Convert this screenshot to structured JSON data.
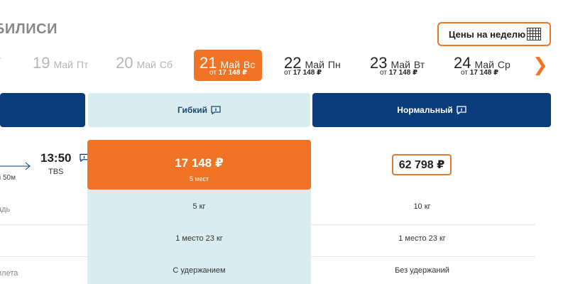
{
  "header": {
    "title": "БИЛИСИ",
    "week_button_label": "Цены на неделю"
  },
  "dates": [
    {
      "day": "",
      "month": "",
      "dow": "т",
      "price_prefix": "",
      "price": "",
      "state": "faded"
    },
    {
      "day": "19",
      "month": "Май",
      "dow": "Пт",
      "price_prefix": "",
      "price": "",
      "state": "faded"
    },
    {
      "day": "20",
      "month": "Май",
      "dow": "Сб",
      "price_prefix": "",
      "price": "",
      "state": "faded"
    },
    {
      "day": "21",
      "month": "Май",
      "dow": "Вс",
      "price_prefix": "от",
      "price": "17 148 ₽",
      "state": "active"
    },
    {
      "day": "22",
      "month": "Май",
      "dow": "Пн",
      "price_prefix": "от",
      "price": "17 148 ₽",
      "state": "normal"
    },
    {
      "day": "23",
      "month": "Май",
      "dow": "Вт",
      "price_prefix": "от",
      "price": "17 148 ₽",
      "state": "normal"
    },
    {
      "day": "24",
      "month": "Май",
      "dow": "Ср",
      "price_prefix": "от",
      "price": "17 148 ₽",
      "state": "normal"
    }
  ],
  "next_arrow": "❯",
  "tariffs": {
    "flexible_label": "Гибкий",
    "normal_label": "Нормальный"
  },
  "flight": {
    "arrival_time": "13:50",
    "arrival_airport": "TBS",
    "duration": "ч 50м"
  },
  "prices": {
    "flexible_amount": "17 148 ₽",
    "flexible_seats": "5 мест",
    "normal_amount": "62 798 ₽"
  },
  "rows": [
    {
      "label": "адь",
      "flexible": "5 кг",
      "normal": "10 кг"
    },
    {
      "label": "",
      "flexible": "1 место 23 кг",
      "normal": "1 место 23 кг"
    },
    {
      "label": "илета",
      "flexible": "С удержанием",
      "normal": "Без удержаний"
    }
  ],
  "colors": {
    "accent": "#f07326",
    "brand_blue": "#0b3d7d",
    "light_blue": "#d9edf1"
  }
}
